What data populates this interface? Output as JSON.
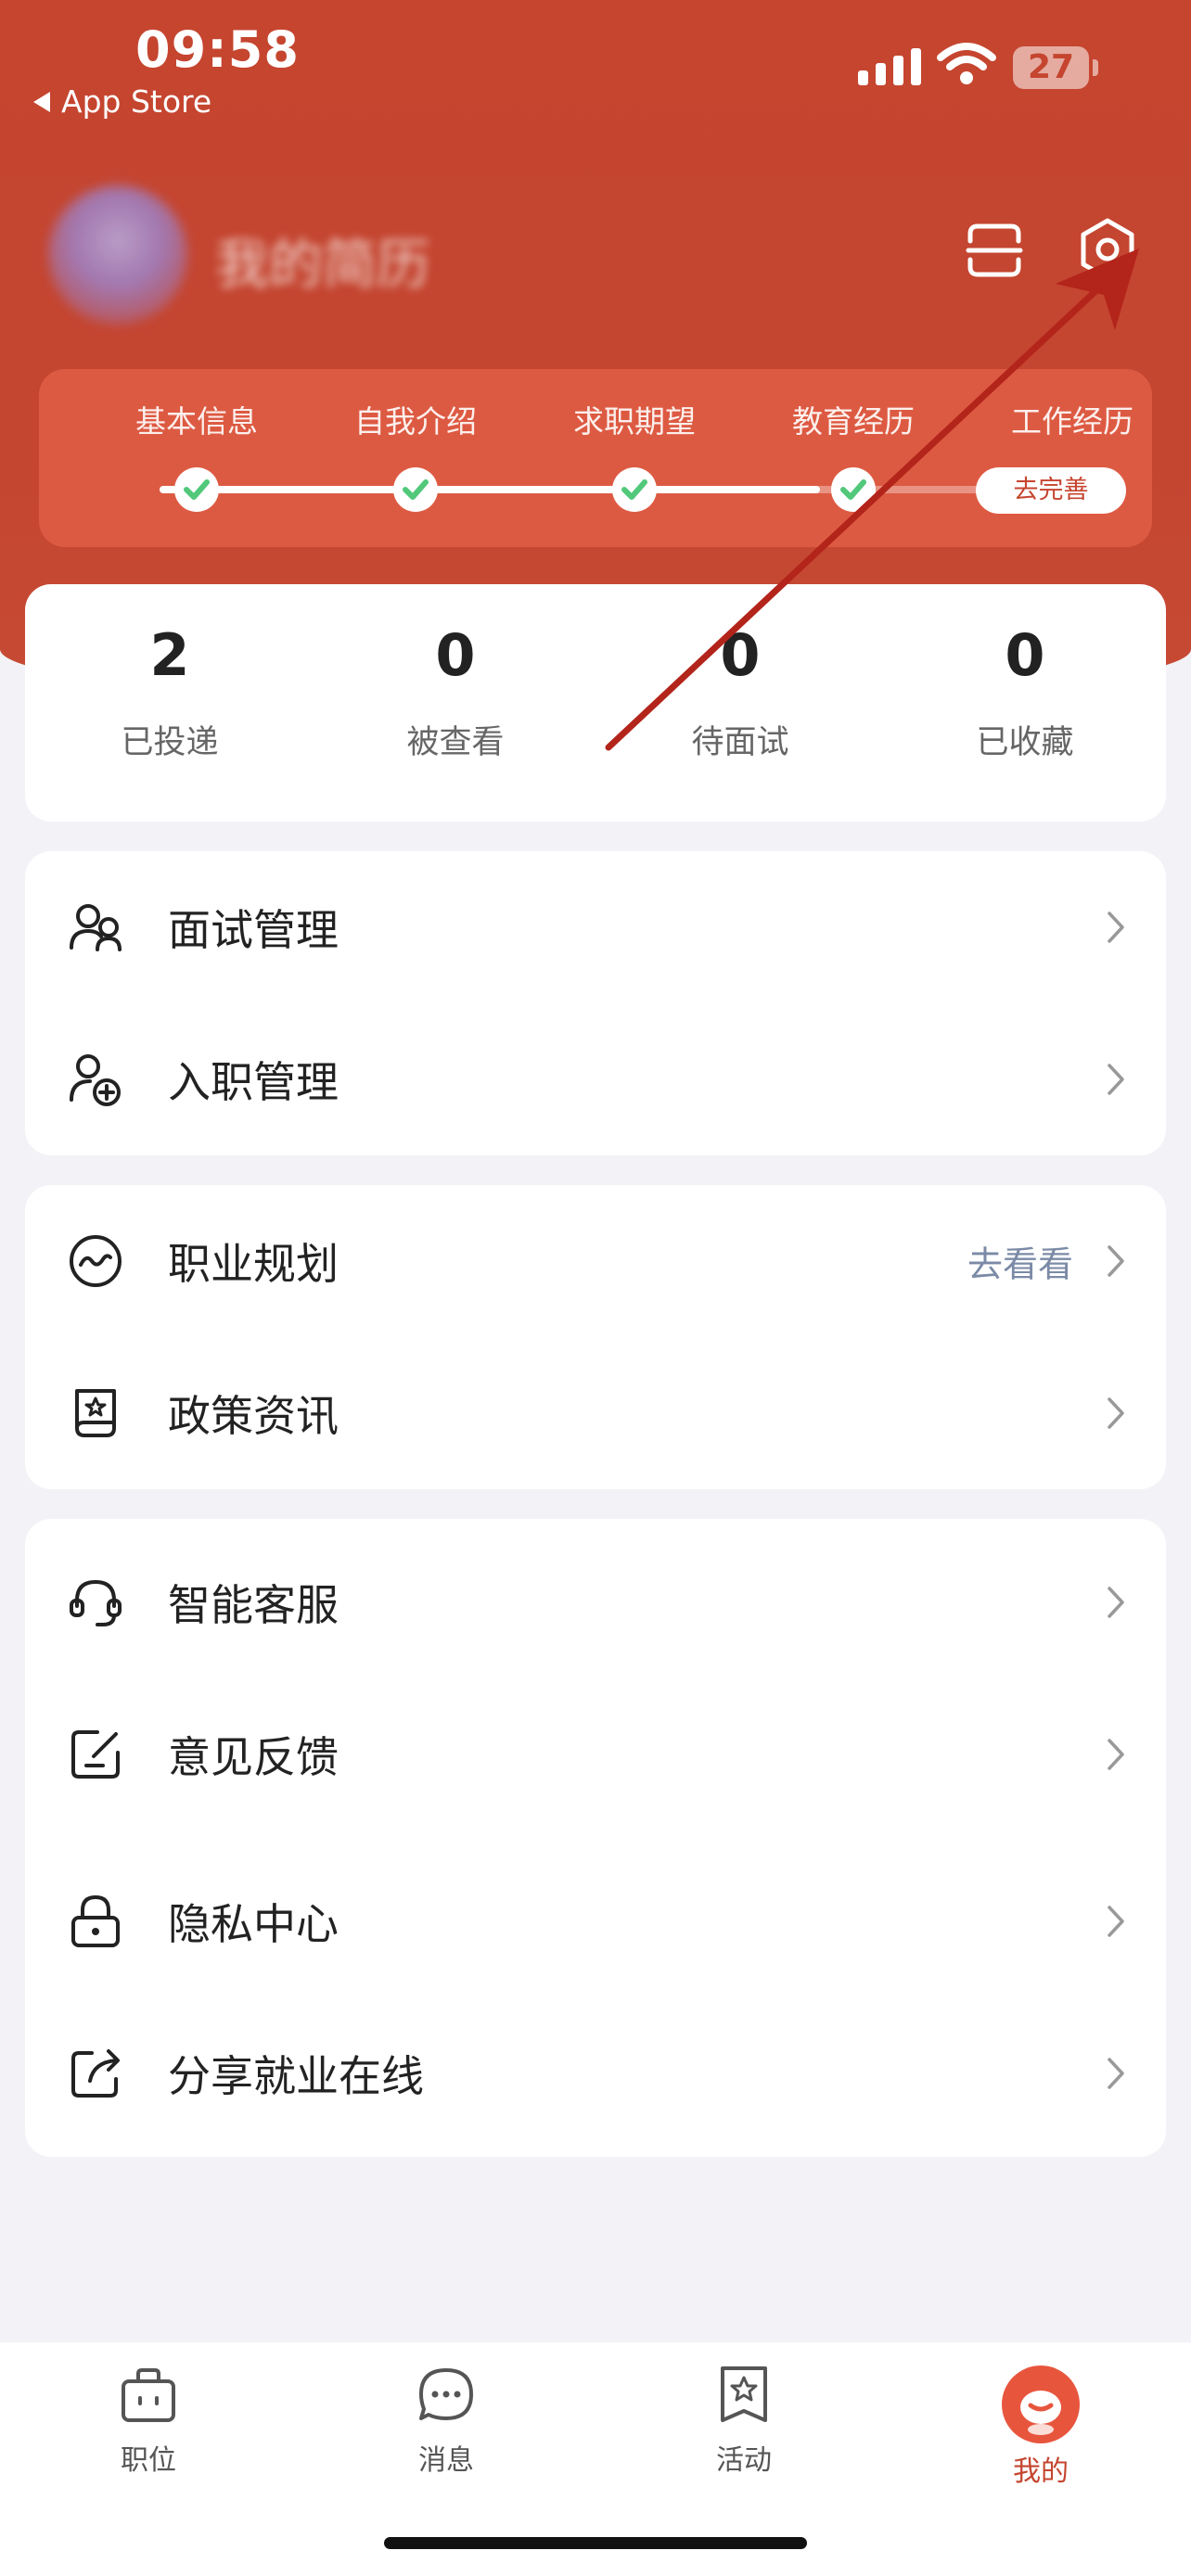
{
  "status_bar": {
    "time": "09:58",
    "back_label": "App Store",
    "battery": "27"
  },
  "profile": {
    "title": "我的简历"
  },
  "progress": {
    "steps": [
      "基本信息",
      "自我介绍",
      "求职期望",
      "教育经历",
      "工作经历"
    ],
    "completed_count": 4,
    "complete_button": "去完善"
  },
  "stats": [
    {
      "value": "2",
      "label": "已投递"
    },
    {
      "value": "0",
      "label": "被查看"
    },
    {
      "value": "0",
      "label": "待面试"
    },
    {
      "value": "0",
      "label": "已收藏"
    }
  ],
  "menu": {
    "group1": [
      {
        "label": "面试管理",
        "icon": "interview-users-icon"
      },
      {
        "label": "入职管理",
        "icon": "add-user-icon"
      }
    ],
    "group2": [
      {
        "label": "职业规划",
        "icon": "career-wave-icon",
        "extra": "去看看"
      },
      {
        "label": "政策资讯",
        "icon": "policy-news-icon"
      }
    ],
    "group3": [
      {
        "label": "智能客服",
        "icon": "headset-icon"
      },
      {
        "label": "意见反馈",
        "icon": "feedback-edit-icon"
      },
      {
        "label": "隐私中心",
        "icon": "lock-icon"
      },
      {
        "label": "分享就业在线",
        "icon": "share-icon"
      }
    ]
  },
  "tabbar": [
    {
      "label": "职位",
      "icon": "briefcase-icon",
      "active": false
    },
    {
      "label": "消息",
      "icon": "chat-bubble-icon",
      "active": false
    },
    {
      "label": "活动",
      "icon": "star-bookmark-icon",
      "active": false
    },
    {
      "label": "我的",
      "icon": "profile-avatar-icon",
      "active": true
    }
  ],
  "colors": {
    "brand": "#c5452f",
    "background": "#f3f3f7",
    "check": "#52c87a",
    "link_gray": "#7b8aa6"
  }
}
